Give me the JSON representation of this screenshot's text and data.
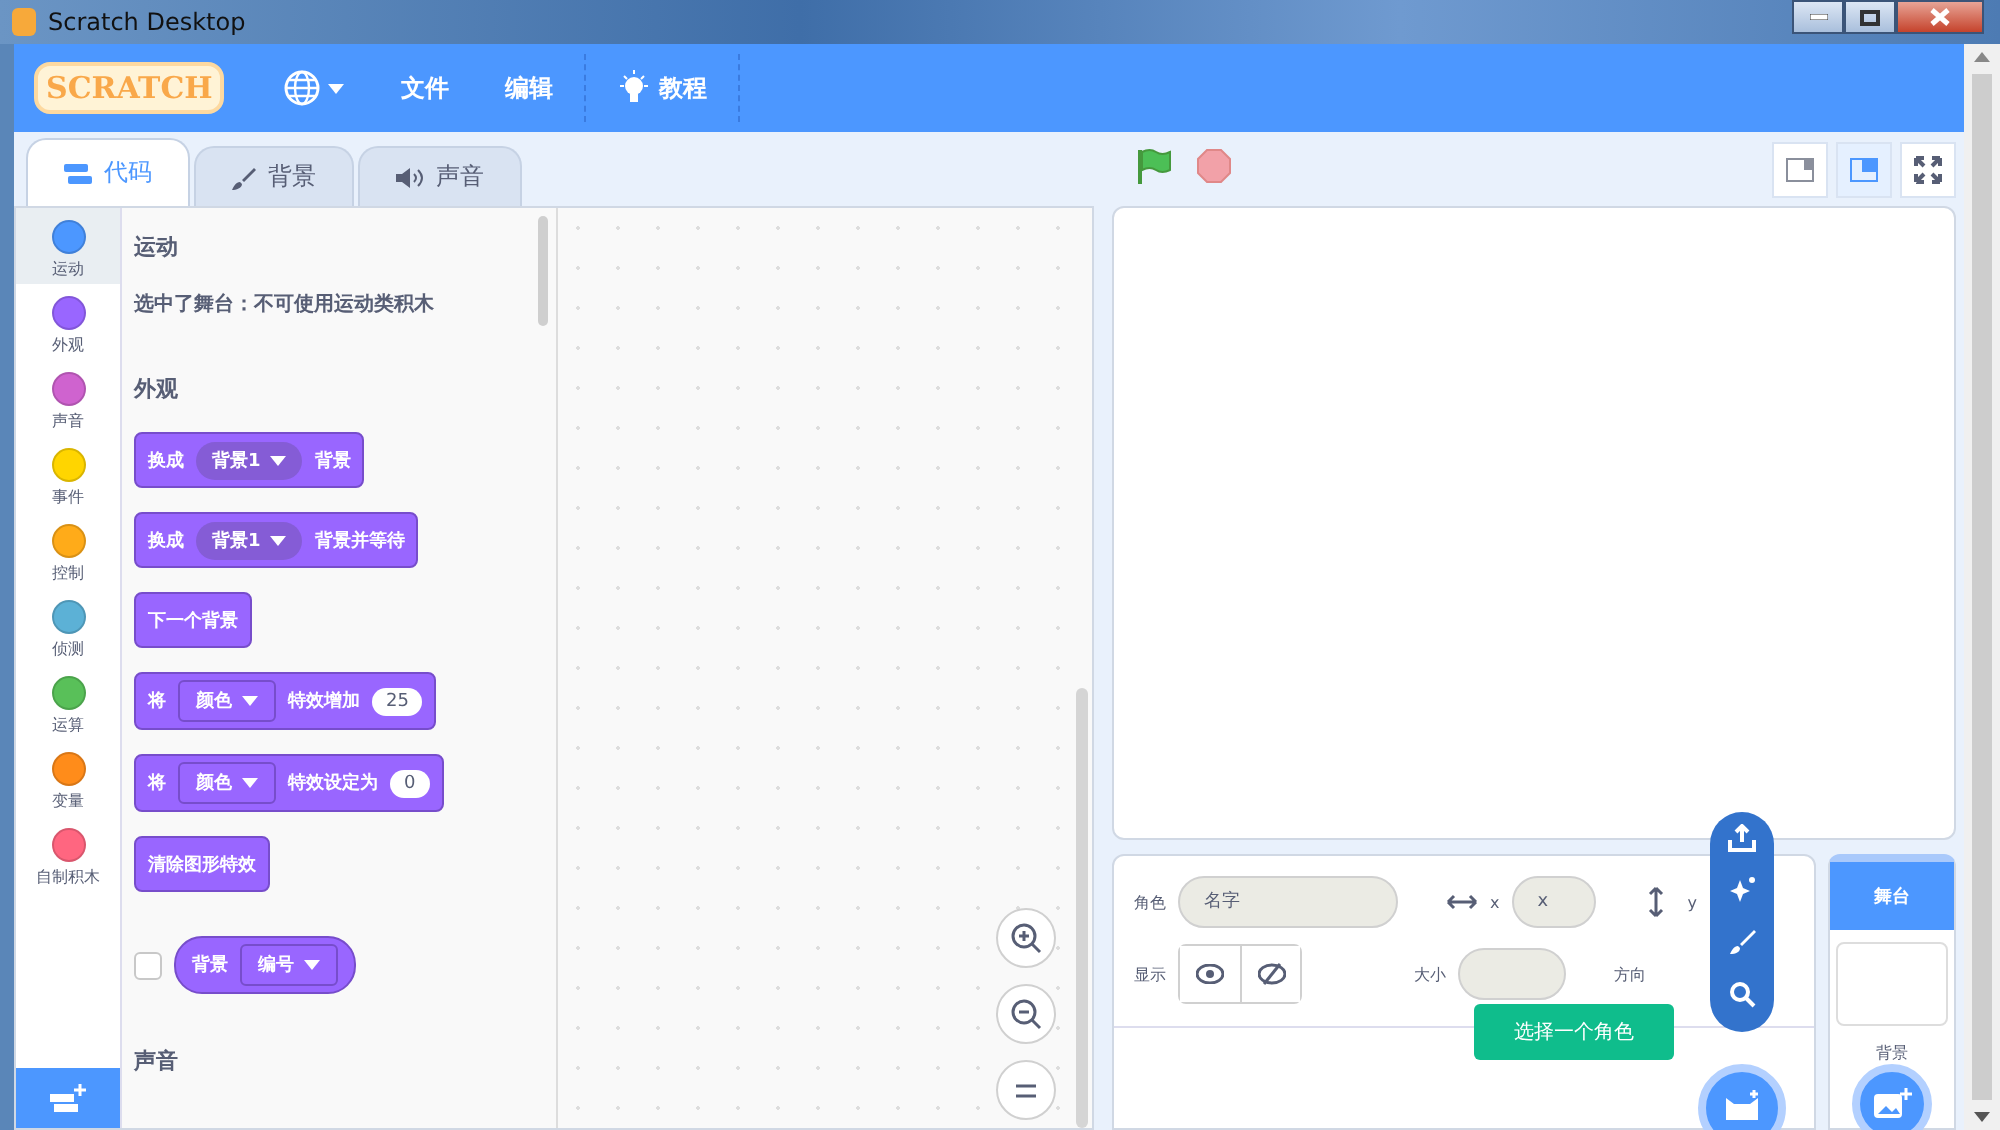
{
  "window": {
    "title": "Scratch Desktop"
  },
  "menu": {
    "logo": "SCRATCH",
    "items": [
      {
        "kind": "language"
      },
      {
        "kind": "text",
        "label": "文件"
      },
      {
        "kind": "text",
        "label": "编辑"
      },
      {
        "kind": "tutorial",
        "label": "教程"
      }
    ]
  },
  "tabs": [
    {
      "kind": "code",
      "label": "代码",
      "selected": true
    },
    {
      "kind": "costume",
      "label": "背景",
      "selected": false
    },
    {
      "kind": "sound",
      "label": "声音",
      "selected": false
    }
  ],
  "categories": [
    {
      "label": "运动",
      "color": "#4c97ff",
      "selected": true
    },
    {
      "label": "外观",
      "color": "#9966ff",
      "selected": false
    },
    {
      "label": "声音",
      "color": "#cf63cf",
      "selected": false
    },
    {
      "label": "事件",
      "color": "#ffd500",
      "selected": false
    },
    {
      "label": "控制",
      "color": "#ffab19",
      "selected": false
    },
    {
      "label": "侦测",
      "color": "#5cb1d6",
      "selected": false
    },
    {
      "label": "运算",
      "color": "#59c059",
      "selected": false
    },
    {
      "label": "变量",
      "color": "#ff8c1a",
      "selected": false
    },
    {
      "label": "自制积木",
      "color": "#ff6680",
      "selected": false
    }
  ],
  "palette": [
    {
      "kind": "heading",
      "text": "运动"
    },
    {
      "kind": "note",
      "text": "选中了舞台：不可使用运动类积木"
    },
    {
      "kind": "heading",
      "text": "外观"
    },
    {
      "kind": "block",
      "parts": [
        {
          "kind": "text",
          "text": "换成"
        },
        {
          "kind": "dropdown",
          "text": "背景1"
        },
        {
          "kind": "text",
          "text": "背景"
        }
      ]
    },
    {
      "kind": "block",
      "parts": [
        {
          "kind": "text",
          "text": "换成"
        },
        {
          "kind": "dropdown",
          "text": "背景1"
        },
        {
          "kind": "text",
          "text": "背景并等待"
        }
      ]
    },
    {
      "kind": "block",
      "parts": [
        {
          "kind": "text",
          "text": "下一个背景"
        }
      ]
    },
    {
      "kind": "block",
      "parts": [
        {
          "kind": "text",
          "text": "将"
        },
        {
          "kind": "menu",
          "text": "颜色"
        },
        {
          "kind": "text",
          "text": "特效增加"
        },
        {
          "kind": "number",
          "text": "25"
        }
      ]
    },
    {
      "kind": "block",
      "parts": [
        {
          "kind": "text",
          "text": "将"
        },
        {
          "kind": "menu",
          "text": "颜色"
        },
        {
          "kind": "text",
          "text": "特效设定为"
        },
        {
          "kind": "number",
          "text": "0"
        }
      ]
    },
    {
      "kind": "block",
      "parts": [
        {
          "kind": "text",
          "text": "清除图形特效"
        }
      ]
    },
    {
      "kind": "reporter",
      "checked": false,
      "parts": [
        {
          "kind": "text",
          "text": "背景"
        },
        {
          "kind": "menu",
          "text": "编号"
        }
      ]
    },
    {
      "kind": "heading",
      "text": "声音"
    }
  ],
  "stage_modes": [
    {
      "kind": "small",
      "selected": false
    },
    {
      "kind": "normal",
      "selected": true
    },
    {
      "kind": "full",
      "selected": false
    }
  ],
  "sprite_info": {
    "sprite_label": "角色",
    "name_placeholder": "名字",
    "x_label": "x",
    "x_placeholder": "x",
    "y_label": "y",
    "show_label": "显示",
    "size_label": "大小",
    "direction_label": "方向"
  },
  "tooltip": "选择一个角色",
  "stage_panel": {
    "title": "舞台",
    "backdrops_label": "背景"
  }
}
